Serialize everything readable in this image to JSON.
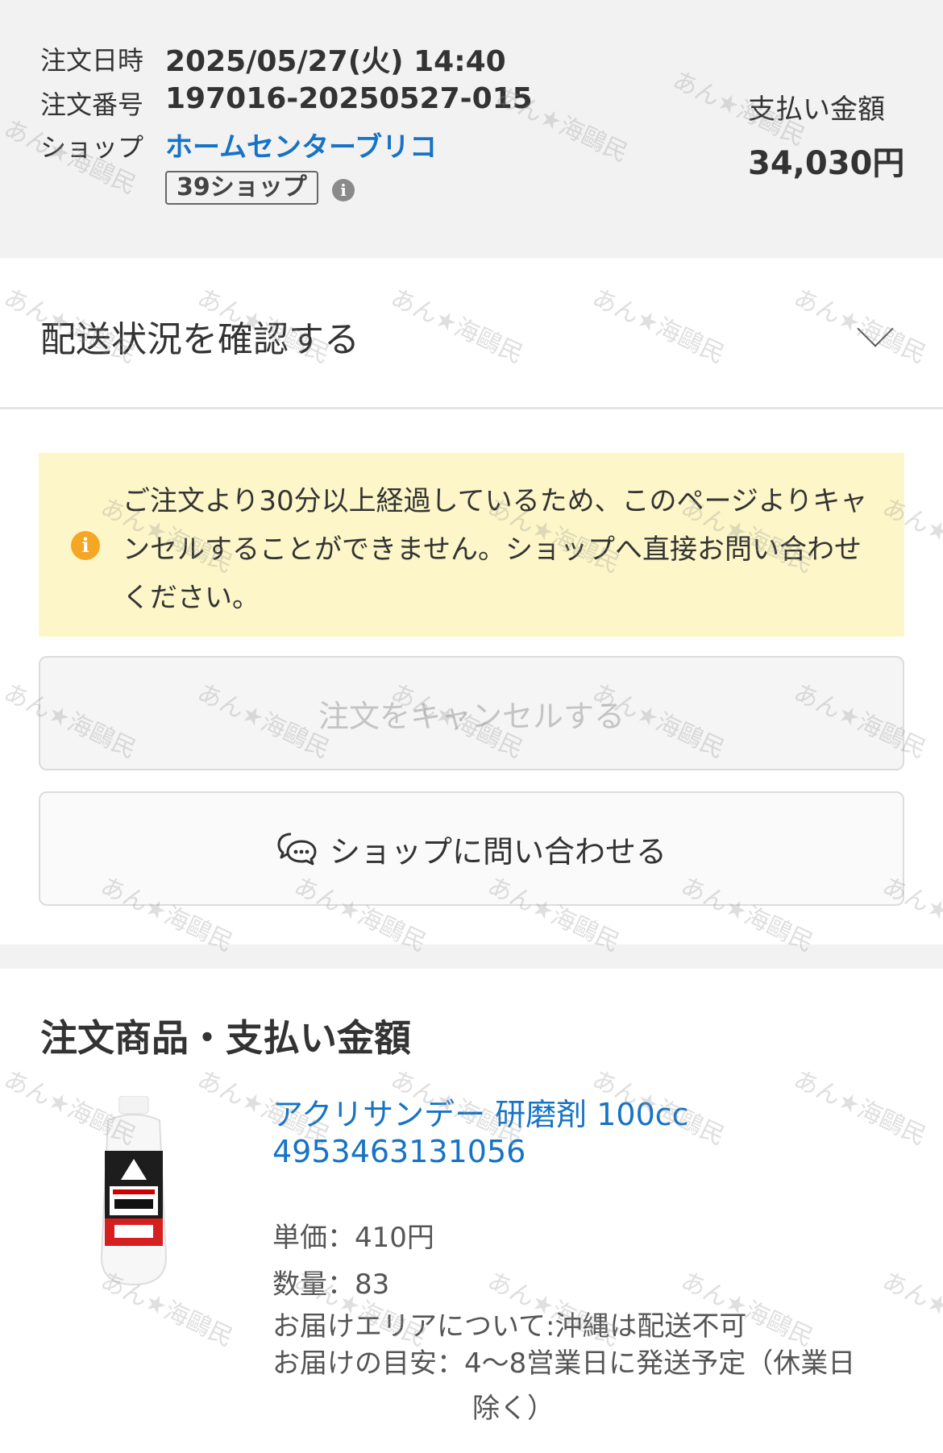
{
  "order": {
    "date_label": "注文日時",
    "date_value": "2025/05/27(火) 14:40",
    "number_label": "注文番号",
    "number_value": "197016-20250527-015",
    "shop_label": "ショップ",
    "shop_name": "ホームセンターブリコ",
    "shop_badge": "39ショップ",
    "payment_label": "支払い金額",
    "payment_value": "34,030円"
  },
  "delivery": {
    "title": "配送状況を確認する"
  },
  "notice": {
    "text": "ご注文より30分以上経過しているため、このページよりキャンセルすることができません。ショップへ直接お問い合わせください。"
  },
  "buttons": {
    "cancel_label": "注文をキャンセルする",
    "contact_label": "ショップに問い合わせる"
  },
  "items_section": {
    "title": "注文商品・支払い金額"
  },
  "product": {
    "name": "アクリサンデー 研磨剤 100cc 4953463131056",
    "unit_price": "単価：410円",
    "quantity": "数量：83",
    "area": "お届けエリアについて:沖縄は配送不可",
    "eta_line1": "お届けの目安：4〜8営業日に発送予定（休業日",
    "eta_line2": "除く）"
  },
  "watermark": "あん★海鷗民"
}
